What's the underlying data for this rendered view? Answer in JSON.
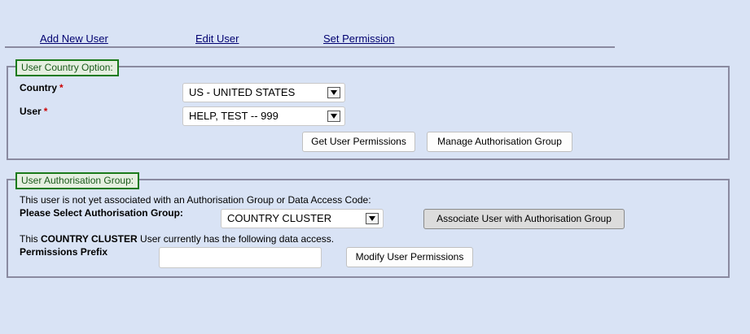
{
  "nav": {
    "add_new_user": "Add New User",
    "edit_user": "Edit User",
    "set_permission": "Set Permission"
  },
  "country_panel": {
    "legend": "User Country Option:",
    "country_label": "Country",
    "user_label": "User",
    "required_mark": "*",
    "country_value": "US - UNITED STATES",
    "user_value": "HELP, TEST -- 999",
    "get_permissions_button": "Get User Permissions",
    "manage_group_button": "Manage Authorisation Group"
  },
  "auth_panel": {
    "legend": "User Authorisation Group:",
    "info_text": "This user is not yet associated with an Authorisation Group or Data Access Code:",
    "select_group_label": "Please Select Authorisation Group:",
    "group_value": "COUNTRY CLUSTER",
    "associate_button": "Associate User with Authorisation Group",
    "access_prefix": "This ",
    "access_group": "COUNTRY CLUSTER",
    "access_suffix": " User currently has the following data access.",
    "permissions_prefix_label": "Permissions Prefix",
    "permissions_prefix_value": "",
    "modify_button": "Modify User Permissions"
  },
  "colors": {
    "background": "#d9e3f5",
    "legend_border": "#1a7a1a",
    "required": "#cc0000",
    "link": "#000070"
  }
}
